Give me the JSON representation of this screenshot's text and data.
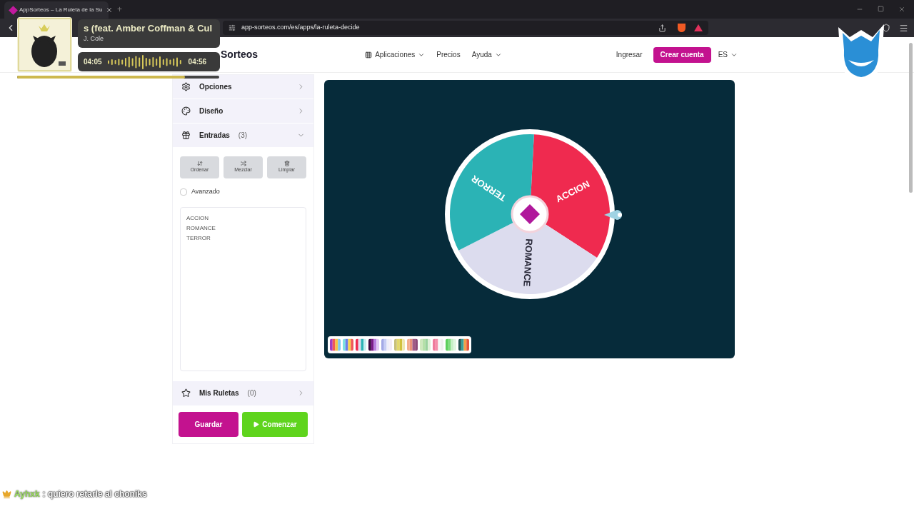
{
  "browser": {
    "tab_title": "AppSorteos – La Ruleta de la Su",
    "new_tab": "+",
    "url": "app-sorteos.com/es/apps/la-ruleta-decide"
  },
  "nav": {
    "logo": "Sorteos",
    "items": [
      {
        "label": "Aplicaciones",
        "kind": "grid-menu"
      },
      {
        "label": "Precios",
        "kind": "link"
      },
      {
        "label": "Ayuda",
        "kind": "menu"
      }
    ],
    "login": "Ingresar",
    "signup": "Crear cuenta",
    "language": "ES"
  },
  "sidebar": {
    "sections": [
      {
        "title": "Opciones",
        "kind": "options",
        "expanded": false
      },
      {
        "title": "Diseño",
        "kind": "design",
        "expanded": false
      },
      {
        "title": "Entradas",
        "count": "(3)",
        "kind": "entries",
        "expanded": true
      }
    ],
    "tools": [
      {
        "label": "Ordenar",
        "kind": "sort"
      },
      {
        "label": "Mezclar",
        "kind": "shuffle"
      },
      {
        "label": "Limpiar",
        "kind": "clear"
      }
    ],
    "advanced": {
      "label": "Avanzado",
      "checked": false
    },
    "entries": [
      "ACCION",
      "ROMANCE",
      "TERROR"
    ],
    "saved": {
      "title": "Mis Ruletas",
      "count": "(0)",
      "expanded": false
    },
    "save_button": "Guardar",
    "start_button": "Comenzar"
  },
  "wheel": {
    "segments": [
      {
        "label": "ACCION",
        "color": "#ef2a4f"
      },
      {
        "label": "ROMANCE",
        "color": "#dcdcee"
      },
      {
        "label": "TERROR",
        "color": "#2bb3b5"
      }
    ]
  },
  "player": {
    "title": "s (feat. Amber Coffman & Cul",
    "artist": "J. Cole",
    "elapsed": "04:05",
    "total": "04:56",
    "level": 0.83
  },
  "chat": {
    "user": "Ayhxk",
    "message": ": quiero retarle al choniks"
  }
}
